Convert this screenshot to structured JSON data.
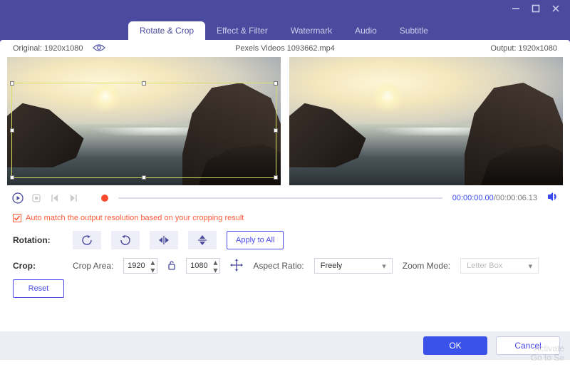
{
  "window": {
    "minimize": "minimize",
    "maximize": "maximize",
    "close": "close"
  },
  "tabs": [
    {
      "label": "Rotate & Crop",
      "active": true
    },
    {
      "label": "Effect & Filter",
      "active": false
    },
    {
      "label": "Watermark",
      "active": false
    },
    {
      "label": "Audio",
      "active": false
    },
    {
      "label": "Subtitle",
      "active": false
    }
  ],
  "meta": {
    "original_label": "Original:",
    "original_res": "1920x1080",
    "filename": "Pexels Videos 1093662.mp4",
    "output_label": "Output:",
    "output_res": "1920x1080"
  },
  "transport": {
    "current_time": "00:00:00.00",
    "sep": "/",
    "duration": "00:00:06.13"
  },
  "auto_match": {
    "checked": true,
    "text": "Auto match the output resolution based on your cropping result"
  },
  "rotation": {
    "label": "Rotation:",
    "apply_all": "Apply to All"
  },
  "crop": {
    "label": "Crop:",
    "area_label": "Crop Area:",
    "width": "1920",
    "height": "1080",
    "aspect_label": "Aspect Ratio:",
    "aspect_value": "Freely",
    "zoom_label": "Zoom Mode:",
    "zoom_value": "Letter Box",
    "reset": "Reset"
  },
  "footer": {
    "ok": "OK",
    "cancel": "Cancel"
  },
  "watermark": {
    "l1": "Activate",
    "l2": "Go to Se"
  }
}
